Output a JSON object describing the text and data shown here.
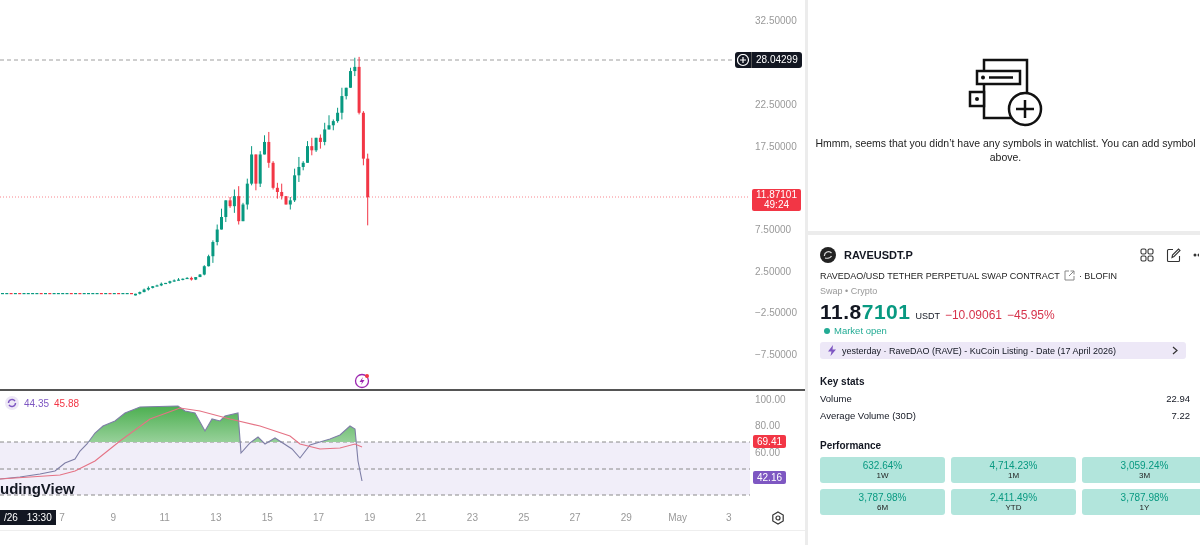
{
  "chart": {
    "price_ticks": [
      "32.50000",
      "22.50000",
      "17.50000",
      "7.50000",
      "2.50000",
      "−2.50000",
      "−7.50000"
    ],
    "high_label": "28.04299",
    "last_price": {
      "value": "11.87101",
      "countdown": "49:24"
    },
    "logo_text": "udingView"
  },
  "rsi": {
    "readouts": [
      {
        "text": "44.35",
        "color": "#7e57c2"
      },
      {
        "text": "45.88",
        "color": "#f23645"
      }
    ],
    "ticks": [
      "100.00",
      "80.00",
      "60.00"
    ],
    "axis_labels": [
      {
        "text": "69.41",
        "color": "#f23645"
      },
      {
        "text": "42.16",
        "color": "#7e57c2"
      }
    ]
  },
  "time_axis": {
    "date_box": "/26 13:30",
    "ticks": [
      "7",
      "9",
      "11",
      "13",
      "15",
      "17",
      "19",
      "21",
      "23",
      "25",
      "27",
      "29",
      "May",
      "3"
    ]
  },
  "watchlist": {
    "message": "Hmmm, seems that you didn’t have any symbols in watchlist. You can add symbol above."
  },
  "symbol": {
    "ticker": "RAVEUSDT.P",
    "description": "RAVEDAO/USD TETHER PERPETUAL SWAP CONTRACT",
    "exchange": "· BLOFIN",
    "category": "Swap • Crypto"
  },
  "quote": {
    "price_lead": "11.8",
    "price_tail": "7101",
    "currency": "USDT",
    "change": "−10.09061",
    "change_percent": "−45.95%",
    "market_status": "Market open",
    "market_open": true
  },
  "news": {
    "text": "yesterday · RaveDAO (RAVE) - KuCoin Listing - Date (17 April 2026)"
  },
  "key_stats": {
    "title": "Key stats",
    "rows": [
      {
        "label": "Volume",
        "value": "22.94"
      },
      {
        "label": "Average Volume (30D)",
        "value": "7.22"
      }
    ]
  },
  "performance": {
    "title": "Performance",
    "cells": [
      {
        "value": "632.64%",
        "period": "1W"
      },
      {
        "value": "4,714.23%",
        "period": "1M"
      },
      {
        "value": "3,059.24%",
        "period": "3M"
      },
      {
        "value": "3,787.98%",
        "period": "6M"
      },
      {
        "value": "2,411.49%",
        "period": "YTD"
      },
      {
        "value": "3,787.98%",
        "period": "1Y"
      }
    ]
  }
}
